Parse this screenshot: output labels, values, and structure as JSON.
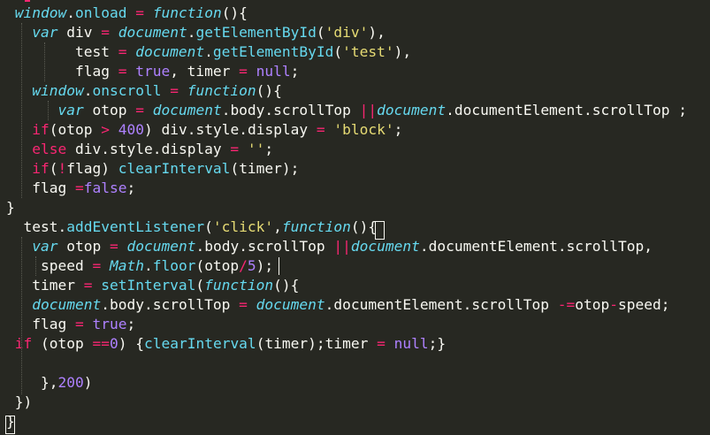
{
  "editor": {
    "theme_colors": {
      "background": "#272822",
      "foreground": "#f8f8f2",
      "keyword": "#f92672",
      "storage": "#66d9ef",
      "string": "#e6db74",
      "number": "#ae81ff"
    },
    "lines": [
      {
        "tokens": [
          [
            "plain",
            " "
          ],
          [
            "storage",
            "window"
          ],
          [
            "punct",
            "."
          ],
          [
            "support",
            "onload"
          ],
          [
            "plain",
            " "
          ],
          [
            "op",
            "="
          ],
          [
            "plain",
            " "
          ],
          [
            "storage",
            "function"
          ],
          [
            "punct",
            "(){"
          ]
        ]
      },
      {
        "tokens": [
          [
            "plain",
            "   "
          ],
          [
            "storage",
            "var"
          ],
          [
            "plain",
            " div "
          ],
          [
            "op",
            "="
          ],
          [
            "plain",
            " "
          ],
          [
            "storage",
            "document"
          ],
          [
            "punct",
            "."
          ],
          [
            "support",
            "getElementById"
          ],
          [
            "punct",
            "("
          ],
          [
            "string",
            "'div'"
          ],
          [
            "punct",
            "),"
          ]
        ]
      },
      {
        "tokens": [
          [
            "plain",
            "        test "
          ],
          [
            "op",
            "="
          ],
          [
            "plain",
            " "
          ],
          [
            "storage",
            "document"
          ],
          [
            "punct",
            "."
          ],
          [
            "support",
            "getElementById"
          ],
          [
            "punct",
            "("
          ],
          [
            "string",
            "'test'"
          ],
          [
            "punct",
            "),"
          ]
        ]
      },
      {
        "tokens": [
          [
            "plain",
            "        flag "
          ],
          [
            "op",
            "="
          ],
          [
            "plain",
            " "
          ],
          [
            "const",
            "true"
          ],
          [
            "punct",
            ","
          ],
          [
            "plain",
            " timer "
          ],
          [
            "op",
            "="
          ],
          [
            "plain",
            " "
          ],
          [
            "const",
            "null"
          ],
          [
            "punct",
            ";"
          ]
        ]
      },
      {
        "tokens": [
          [
            "plain",
            "   "
          ],
          [
            "storage",
            "window"
          ],
          [
            "punct",
            "."
          ],
          [
            "support",
            "onscroll"
          ],
          [
            "plain",
            " "
          ],
          [
            "op",
            "="
          ],
          [
            "plain",
            " "
          ],
          [
            "storage",
            "function"
          ],
          [
            "punct",
            "(){"
          ]
        ]
      },
      {
        "tokens": [
          [
            "plain",
            "      "
          ],
          [
            "storage",
            "var"
          ],
          [
            "plain",
            " otop "
          ],
          [
            "op",
            "="
          ],
          [
            "plain",
            " "
          ],
          [
            "storage",
            "document"
          ],
          [
            "punct",
            "."
          ],
          [
            "plain",
            "body"
          ],
          [
            "punct",
            "."
          ],
          [
            "plain",
            "scrollTop "
          ],
          [
            "op",
            "||"
          ],
          [
            "storage",
            "document"
          ],
          [
            "punct",
            "."
          ],
          [
            "plain",
            "documentElement"
          ],
          [
            "punct",
            "."
          ],
          [
            "plain",
            "scrollTop ;"
          ]
        ]
      },
      {
        "tokens": [
          [
            "plain",
            "   "
          ],
          [
            "keyword",
            "if"
          ],
          [
            "punct",
            "("
          ],
          [
            "plain",
            "otop "
          ],
          [
            "op",
            ">"
          ],
          [
            "plain",
            " "
          ],
          [
            "number",
            "400"
          ],
          [
            "punct",
            ")"
          ],
          [
            "plain",
            " div"
          ],
          [
            "punct",
            "."
          ],
          [
            "plain",
            "style"
          ],
          [
            "punct",
            "."
          ],
          [
            "plain",
            "display "
          ],
          [
            "op",
            "="
          ],
          [
            "plain",
            " "
          ],
          [
            "string",
            "'block'"
          ],
          [
            "punct",
            ";"
          ]
        ]
      },
      {
        "tokens": [
          [
            "plain",
            "   "
          ],
          [
            "keyword",
            "else"
          ],
          [
            "plain",
            " div"
          ],
          [
            "punct",
            "."
          ],
          [
            "plain",
            "style"
          ],
          [
            "punct",
            "."
          ],
          [
            "plain",
            "display "
          ],
          [
            "op",
            "="
          ],
          [
            "plain",
            " "
          ],
          [
            "string",
            "''"
          ],
          [
            "punct",
            ";"
          ]
        ]
      },
      {
        "tokens": [
          [
            "plain",
            "   "
          ],
          [
            "keyword",
            "if"
          ],
          [
            "punct",
            "("
          ],
          [
            "op",
            "!"
          ],
          [
            "plain",
            "flag"
          ],
          [
            "punct",
            ")"
          ],
          [
            "plain",
            " "
          ],
          [
            "fn",
            "clearInterval"
          ],
          [
            "punct",
            "("
          ],
          [
            "plain",
            "timer"
          ],
          [
            "punct",
            ");"
          ]
        ]
      },
      {
        "tokens": [
          [
            "plain",
            "   flag "
          ],
          [
            "op",
            "="
          ],
          [
            "const",
            "false"
          ],
          [
            "punct",
            ";"
          ]
        ]
      },
      {
        "tokens": [
          [
            "punct",
            "}"
          ]
        ]
      },
      {
        "tokens": [
          [
            "plain",
            "  test"
          ],
          [
            "punct",
            "."
          ],
          [
            "support",
            "addEventListener"
          ],
          [
            "punct",
            "("
          ],
          [
            "string",
            "'click'"
          ],
          [
            "punct",
            ","
          ],
          [
            "storage",
            "function"
          ],
          [
            "punct",
            "(){"
          ]
        ]
      },
      {
        "tokens": [
          [
            "plain",
            "   "
          ],
          [
            "storage",
            "var"
          ],
          [
            "plain",
            " otop "
          ],
          [
            "op",
            "="
          ],
          [
            "plain",
            " "
          ],
          [
            "storage",
            "document"
          ],
          [
            "punct",
            "."
          ],
          [
            "plain",
            "body"
          ],
          [
            "punct",
            "."
          ],
          [
            "plain",
            "scrollTop "
          ],
          [
            "op",
            "||"
          ],
          [
            "storage",
            "document"
          ],
          [
            "punct",
            "."
          ],
          [
            "plain",
            "documentElement"
          ],
          [
            "punct",
            "."
          ],
          [
            "plain",
            "scrollTop,"
          ]
        ]
      },
      {
        "tokens": [
          [
            "plain",
            "    speed "
          ],
          [
            "op",
            "="
          ],
          [
            "plain",
            " "
          ],
          [
            "storage",
            "Math"
          ],
          [
            "punct",
            "."
          ],
          [
            "support",
            "floor"
          ],
          [
            "punct",
            "("
          ],
          [
            "plain",
            "otop"
          ],
          [
            "op",
            "/"
          ],
          [
            "number",
            "5"
          ],
          [
            "punct",
            ");"
          ]
        ]
      },
      {
        "tokens": [
          [
            "plain",
            "   timer "
          ],
          [
            "op",
            "="
          ],
          [
            "plain",
            " "
          ],
          [
            "fn",
            "setInterval"
          ],
          [
            "punct",
            "("
          ],
          [
            "storage",
            "function"
          ],
          [
            "punct",
            "(){"
          ]
        ]
      },
      {
        "tokens": [
          [
            "plain",
            "   "
          ],
          [
            "storage",
            "document"
          ],
          [
            "punct",
            "."
          ],
          [
            "plain",
            "body"
          ],
          [
            "punct",
            "."
          ],
          [
            "plain",
            "scrollTop "
          ],
          [
            "op",
            "="
          ],
          [
            "plain",
            " "
          ],
          [
            "storage",
            "document"
          ],
          [
            "punct",
            "."
          ],
          [
            "plain",
            "documentElement"
          ],
          [
            "punct",
            "."
          ],
          [
            "plain",
            "scrollTop "
          ],
          [
            "op",
            "-="
          ],
          [
            "plain",
            "otop"
          ],
          [
            "op",
            "-"
          ],
          [
            "plain",
            "speed"
          ],
          [
            "punct",
            ";"
          ]
        ]
      },
      {
        "tokens": [
          [
            "plain",
            "   flag "
          ],
          [
            "op",
            "="
          ],
          [
            "plain",
            " "
          ],
          [
            "const",
            "true"
          ],
          [
            "punct",
            ";"
          ]
        ]
      },
      {
        "tokens": [
          [
            "plain",
            " "
          ],
          [
            "keyword",
            "if"
          ],
          [
            "plain",
            " (otop "
          ],
          [
            "op",
            "=="
          ],
          [
            "number",
            "0"
          ],
          [
            "punct",
            ")"
          ],
          [
            "plain",
            " {"
          ],
          [
            "fn",
            "clearInterval"
          ],
          [
            "punct",
            "("
          ],
          [
            "plain",
            "timer"
          ],
          [
            "punct",
            ");"
          ],
          [
            "plain",
            "timer "
          ],
          [
            "op",
            "="
          ],
          [
            "plain",
            " "
          ],
          [
            "const",
            "null"
          ],
          [
            "punct",
            ";}"
          ]
        ]
      },
      {
        "tokens": []
      },
      {
        "tokens": [
          [
            "plain",
            "    },"
          ],
          [
            "number",
            "200"
          ],
          [
            "punct",
            ")"
          ]
        ]
      },
      {
        "tokens": [
          [
            "plain",
            " })"
          ]
        ]
      },
      {
        "tokens": [
          [
            "punct",
            "}"
          ]
        ]
      }
    ]
  }
}
